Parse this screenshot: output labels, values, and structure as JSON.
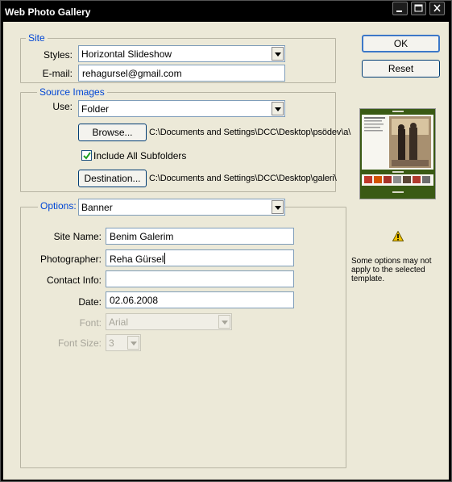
{
  "window": {
    "title": "Web Photo Gallery"
  },
  "site": {
    "legend": "Site",
    "styles_label": "Styles:",
    "styles_value": "Horizontal Slideshow",
    "email_label": "E-mail:",
    "email_value": "rehagursel@gmail.com"
  },
  "source_images": {
    "legend": "Source Images",
    "use_label": "Use:",
    "use_value": "Folder",
    "browse_label": "Browse...",
    "browse_path": "C:\\Documents and Settings\\DCC\\Desktop\\psödev\\a\\",
    "include_subfolders_label": "Include All Subfolders",
    "include_subfolders_checked": true,
    "destination_label": "Destination...",
    "destination_path": "C:\\Documents and Settings\\DCC\\Desktop\\galeri\\"
  },
  "options": {
    "legend": "Options:",
    "selected": "Banner",
    "site_name_label": "Site Name:",
    "site_name_value": "Benim Galerim",
    "photographer_label": "Photographer:",
    "photographer_value": "Reha Gürsel",
    "contact_info_label": "Contact Info:",
    "contact_info_value": "",
    "date_label": "Date:",
    "date_value": "02.06.2008",
    "font_label": "Font:",
    "font_value": "Arial",
    "font_size_label": "Font Size:",
    "font_size_value": "3"
  },
  "buttons": {
    "ok": "OK",
    "reset": "Reset"
  },
  "warning": {
    "text": "Some options may not apply to the selected template."
  },
  "colors": {
    "legend_blue": "#0046d5",
    "dialog_bg": "#ece9d8",
    "preview_green": "#3a5a14"
  }
}
